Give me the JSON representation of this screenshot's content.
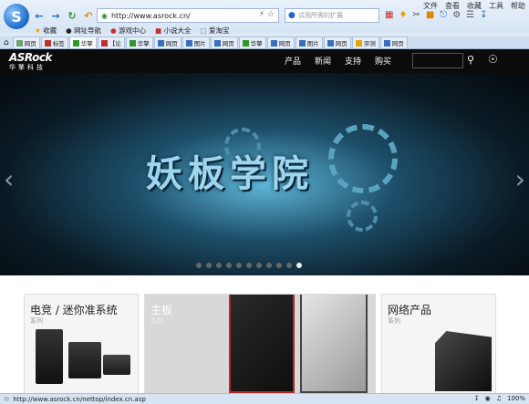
{
  "browser": {
    "menu": [
      "文件",
      "查看",
      "收藏",
      "工具",
      "帮助"
    ],
    "address": "http://www.asrock.cn/",
    "search_placeholder": "试用所需的扩展",
    "favorites": [
      "收藏",
      "网址导航",
      "游戏中心",
      "小说大全",
      "爱淘宝"
    ],
    "tabs": [
      "网页",
      "标签",
      "华擎",
      "【论",
      "华擎",
      "网页",
      "图片",
      "网页",
      "华擎",
      "网页",
      "图片",
      "网页",
      "评测",
      "网页",
      "网页"
    ],
    "status_url": "http://www.asrock.cn/nettop/index.cn.asp",
    "zoom": "100%"
  },
  "site": {
    "logo_brand": "ASRock",
    "logo_sub": "华擎科技",
    "nav": [
      "产品",
      "新闻",
      "支持",
      "购买"
    ],
    "banner_title": "妖板学院",
    "banner_dots": 11,
    "banner_active_dot": 10,
    "products": [
      {
        "title": "电竞 / 迷你准系统",
        "subtitle": "系列"
      },
      {
        "title": "主板",
        "subtitle": "系列"
      },
      {
        "title": "网络产品",
        "subtitle": "系列"
      }
    ]
  }
}
